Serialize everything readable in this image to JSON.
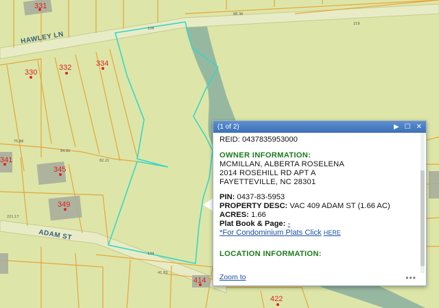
{
  "map": {
    "lot_numbers": [
      "331",
      "330",
      "332",
      "334",
      "345",
      "349",
      "341",
      "414",
      "422"
    ],
    "streets": [
      "HAWLEY LN",
      "ADAM ST"
    ],
    "colors": {
      "land": "#dde6a8",
      "parcel_line": "#e7a43a",
      "selected_parcel": "#35d6c8",
      "river": "#8fb39f",
      "building": "#a9ad9c"
    }
  },
  "popup": {
    "counter": "(1 of 2)",
    "reid": "REID: 0437835953000",
    "owner_title": "OWNER INFORMATION:",
    "owner_name": "MCMILLAN, ALBERTA ROSELENA",
    "owner_address1": "2014 ROSEHILL RD APT A",
    "owner_address2": "FAYETTEVILLE, NC 28301",
    "pin_label": "PIN:",
    "pin_value": "0437-83-5953",
    "property_label": "PROPERTY DESC:",
    "property_value": "VAC 409 ADAM ST (1.66 AC)",
    "acres_label": "ACRES:",
    "acres_value": "1.66",
    "platbook_label": "Plat Book & Page:",
    "platbook_value": "-",
    "condo_text": "*For Condominium Plats Click",
    "condo_link": "HERE",
    "location_title": "LOCATION INFORMATION:",
    "zoom_to": "Zoom to",
    "more": "•••",
    "icons": [
      "next-icon",
      "maximize-icon",
      "close-icon"
    ]
  }
}
